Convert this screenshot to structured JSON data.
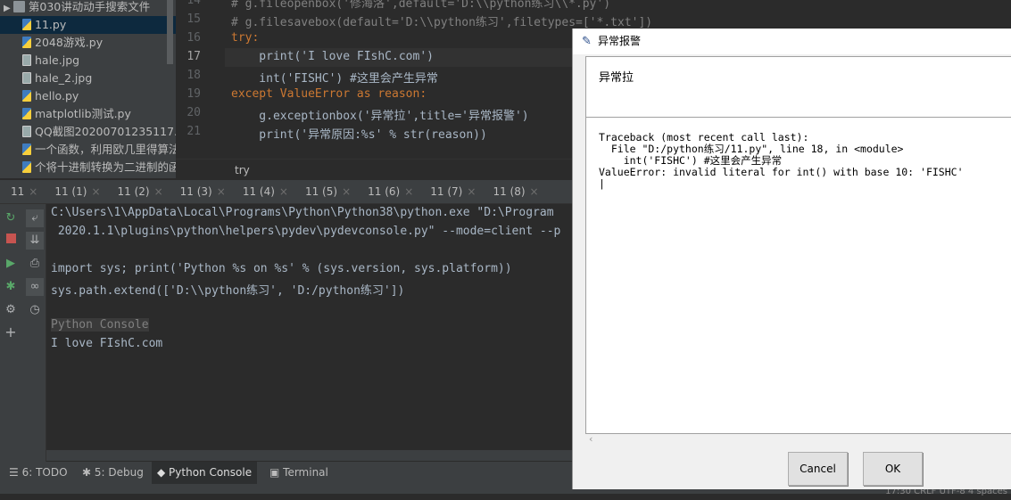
{
  "project_tree": {
    "items": [
      {
        "label": "第030讲动动手搜索文件",
        "type": "folder"
      },
      {
        "label": "11.py",
        "type": "py",
        "selected": true
      },
      {
        "label": "2048游戏.py",
        "type": "py"
      },
      {
        "label": "hale.jpg",
        "type": "img"
      },
      {
        "label": "hale_2.jpg",
        "type": "img"
      },
      {
        "label": "hello.py",
        "type": "py"
      },
      {
        "label": "matplotlib测试.py",
        "type": "py"
      },
      {
        "label": "QQ截图20200701235117.png",
        "type": "img"
      },
      {
        "label": "一个函数，利用欧几里得算法",
        "type": "py"
      },
      {
        "label": "个将十进制转换为二进制的函数",
        "type": "py"
      }
    ]
  },
  "editor": {
    "lines": [
      {
        "n": "14",
        "code": "# g.fileopenbox('修海洛',default='D:\\\\python练习\\\\*.py')"
      },
      {
        "n": "15",
        "code": "# g.filesavebox(default='D:\\\\python练习',filetypes=['*.txt'])"
      },
      {
        "n": "16",
        "code": "try:"
      },
      {
        "n": "17",
        "code": "    print('I love FIshC.com')"
      },
      {
        "n": "18",
        "code": "    int('FISHC') #这里会产生异常"
      },
      {
        "n": "19",
        "code": "except ValueError as reason:"
      },
      {
        "n": "20",
        "code": "    g.exceptionbox('异常拉',title='异常报警')"
      },
      {
        "n": "21",
        "code": "    print('异常原因:%s' % str(reason))"
      }
    ],
    "breadcrumb": "try"
  },
  "console_tabs": [
    "11",
    "11 (1)",
    "11 (2)",
    "11 (3)",
    "11 (4)",
    "11 (5)",
    "11 (6)",
    "11 (7)",
    "11 (8)"
  ],
  "console": {
    "lines": [
      "C:\\Users\\1\\AppData\\Local\\Programs\\Python\\Python38\\python.exe \"D:\\Program",
      " 2020.1.1\\plugins\\python\\helpers\\pydev\\pydevconsole.py\" --mode=client --p",
      "",
      "import sys; print('Python %s on %s' % (sys.version, sys.platform))",
      "sys.path.extend(['D:\\\\python练习', 'D:/python练习'])",
      "",
      "Python Console",
      "I love FIshC.com"
    ]
  },
  "bottom_tabs": [
    {
      "label": "6: TODO"
    },
    {
      "label": "5: Debug"
    },
    {
      "label": "Python Console",
      "active": true
    },
    {
      "label": "Terminal"
    }
  ],
  "status": "17:30  CRLF  UTF-8  4 spaces",
  "dialog": {
    "title": "异常报警",
    "message": "异常拉",
    "traceback": "Traceback (most recent call last):\n  File \"D:/python练习/11.py\", line 18, in <module>\n    int('FISHC') #这里会产生异常\nValueError: invalid literal for int() with base 10: 'FISHC'\n|",
    "cancel": "Cancel",
    "ok": "OK"
  }
}
